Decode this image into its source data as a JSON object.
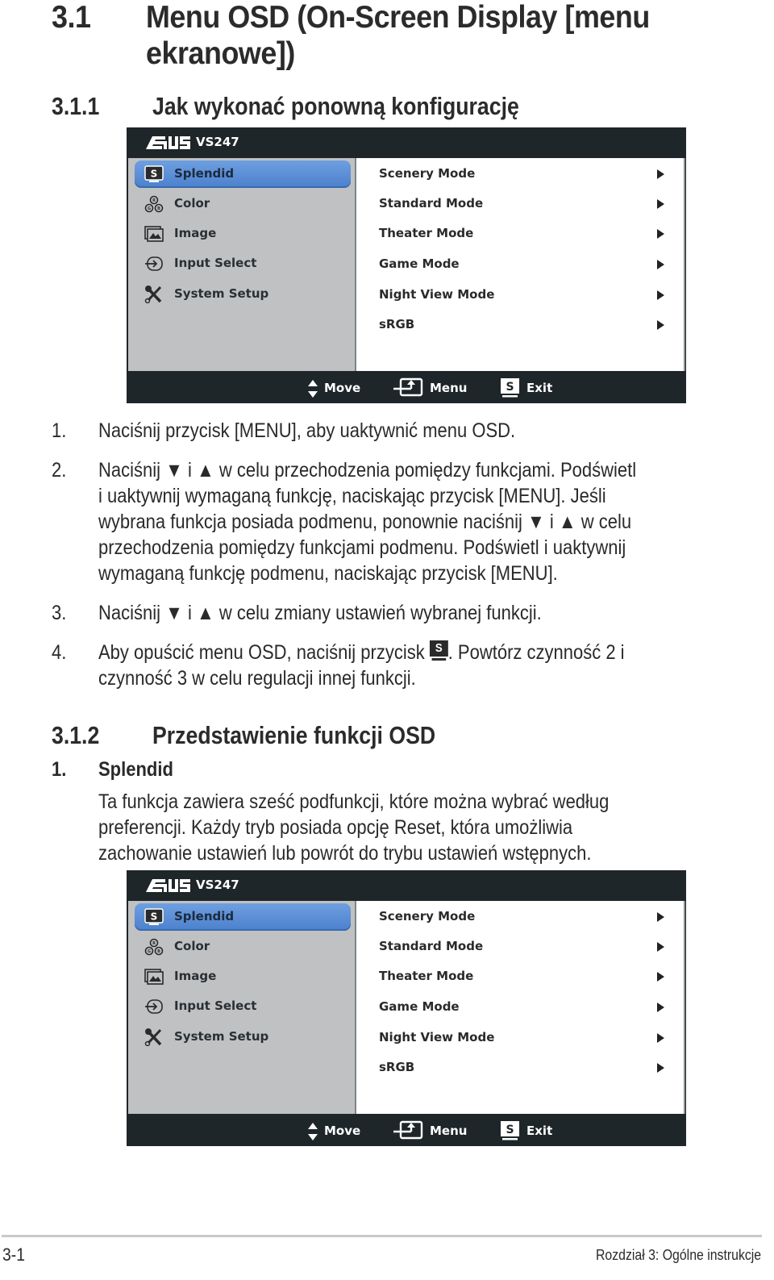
{
  "section": {
    "number": "3.1",
    "title_line1": "Menu OSD (On-Screen Display [menu",
    "title_line2": "ekranowe])"
  },
  "subsection_1": {
    "number": "3.1.1",
    "title": "Jak wykonać ponowną konfigurację"
  },
  "osd": {
    "brand": "ASUS",
    "model": "VS247",
    "menu_items": [
      {
        "label": "Splendid",
        "icon": "splendid-s-icon",
        "selected": true
      },
      {
        "label": "Color",
        "icon": "rgb-color-icon",
        "selected": false
      },
      {
        "label": "Image",
        "icon": "image-icon",
        "selected": false
      },
      {
        "label": "Input Select",
        "icon": "input-select-icon",
        "selected": false
      },
      {
        "label": "System Setup",
        "icon": "wrench-screwdriver-icon",
        "selected": false
      }
    ],
    "submenu_items": [
      {
        "label": "Scenery Mode"
      },
      {
        "label": "Standard Mode"
      },
      {
        "label": "Theater Mode"
      },
      {
        "label": "Game Mode"
      },
      {
        "label": "Night View Mode"
      },
      {
        "label": "sRGB"
      }
    ],
    "footer": {
      "move": "Move",
      "menu": "Menu",
      "exit": "Exit",
      "exit_key": "S"
    },
    "colors": {
      "frame": "#1e2629",
      "left_panel": "#bfc1c3",
      "selected": "#5a8ed6",
      "right_panel": "#ffffff"
    }
  },
  "steps": [
    {
      "num": "1.",
      "lines": [
        "Naciśnij przycisk [MENU], aby uaktywnić menu OSD."
      ]
    },
    {
      "num": "2.",
      "lines": [
        "Naciśnij ▼ i ▲ w celu przechodzenia pomiędzy funkcjami. Podświetl",
        "i uaktywnij wymaganą funkcję, naciskając przycisk [MENU]. Jeśli",
        "wybrana funkcja posiada podmenu, ponownie naciśnij ▼ i ▲ w celu",
        "przechodzenia pomiędzy funkcjami podmenu. Podświetl i uaktywnij",
        "wymaganą funkcję podmenu, naciskając przycisk [MENU]."
      ]
    },
    {
      "num": "3.",
      "lines": [
        "Naciśnij ▼ i ▲ w celu zmiany ustawień wybranej funkcji."
      ]
    },
    {
      "num": "4.",
      "line1_before": "Aby opuścić menu OSD, naciśnij przycisk ",
      "line1_key": "S",
      "line1_after": ". Powtórz czynność 2 i",
      "lines": [
        "czynność 3 w celu regulacji innej funkcji."
      ]
    }
  ],
  "subsection_2": {
    "number": "3.1.2",
    "title": "Przedstawienie funkcji OSD"
  },
  "feature_1": {
    "num": "1.",
    "title": "Splendid",
    "lines": [
      "Ta funkcja zawiera sześć podfunkcji, które można wybrać według",
      "preferencji. Każdy tryb posiada opcję Reset, która umożliwia",
      "zachowanie ustawień lub powrót do trybu ustawień wstępnych."
    ]
  },
  "page_footer": {
    "page_number": "3-1",
    "chapter": "Rozdział 3: Ogólne instrukcje"
  }
}
